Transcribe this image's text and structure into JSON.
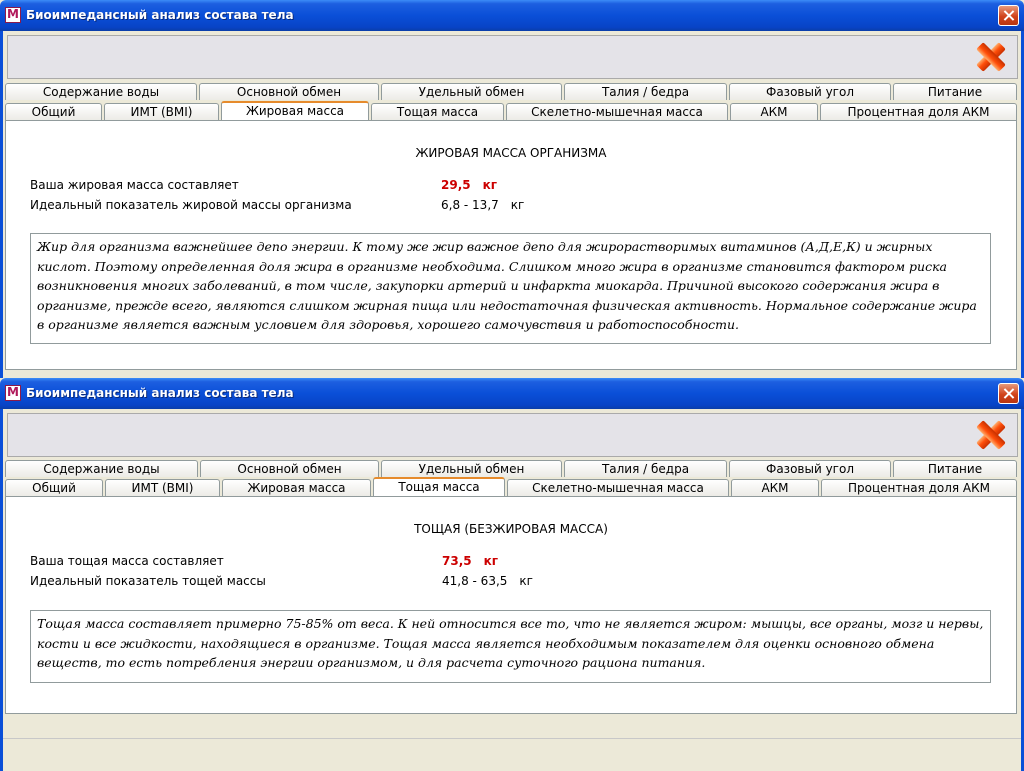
{
  "window_title": "Биоимпедансный анализ состава тела",
  "app_icon_letter": "M",
  "tabs_row1": [
    "Содержание воды",
    "Основной обмен",
    "Удельный обмен",
    "Талия / бедра",
    "Фазовый угол",
    "Питание"
  ],
  "tabs_row2": [
    "Общий",
    "ИМТ (BMI)",
    "Жировая масса",
    "Тощая масса",
    "Скелетно-мышечная масса",
    "АКМ",
    "Процентная доля АКМ"
  ],
  "windows": [
    {
      "active_tab": "Жировая масса",
      "heading": "ЖИРОВАЯ МАССА ОРГАНИЗМА",
      "row1_label": "Ваша жировая масса составляет",
      "row1_value": "29,5",
      "row1_unit": "кг",
      "row2_label": "Идеальный показатель жировой массы организма",
      "row2_value": "6,8 - 13,7",
      "row2_unit": "кг",
      "description": "Жир для организма важнейшее депо энергии. К тому же жир важное депо для жирорастворимых витаминов (А,Д,Е,К) и жирных кислот. Поэтому определенная доля жира в организме необходима. Слишком много жира в организме становится фактором риска возникновения многих заболеваний, в том числе, закупорки артерий и инфаркта миокарда. Причиной высокого содержания жира в организме, прежде всего, являются слишком жирная пища или недостаточная физическая активность. Нормальное содержание жира в организме является важным условием для здоровья, хорошего самочувствия и работоспособности."
    },
    {
      "active_tab": "Тощая масса",
      "heading": "ТОЩАЯ  (БЕЗЖИРОВАЯ МАССА)",
      "row1_label": "Ваша тощая масса составляет",
      "row1_value": "73,5",
      "row1_unit": "кг",
      "row2_label": "Идеальный показатель тощей массы",
      "row2_value": "41,8 - 63,5",
      "row2_unit": "кг",
      "description": "Тощая масса составляет примерно 75-85% от веса. К ней относится все то, что не является жиром: мышцы, все органы, мозг и нервы, кости и все жидкости, находящиеся в организме. Тощая масса является необходимым показателем для оценки основного обмена веществ, то есть потребления энергии организмом, и для расчета суточного рациона питания."
    }
  ]
}
